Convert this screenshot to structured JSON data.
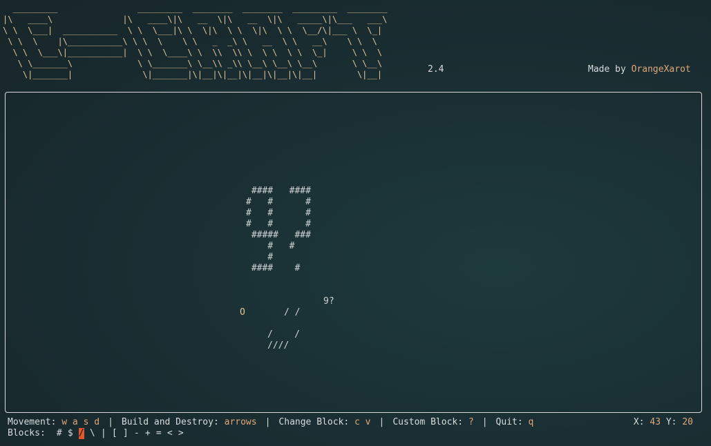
{
  "header": {
    "logo_art": "  _________                _________  ________  ________  _________  ________\n|\\   ____\\              |\\   ____\\|\\   __  \\|\\   __  \\|\\   _____\\|\\___   ___\\\n\\ \\  \\___|  ___________  \\ \\  \\___|\\ \\  \\|\\  \\ \\  \\|\\  \\ \\  \\__/\\|___ \\  \\_|\n \\ \\  \\    |\\___________\\ \\ \\  \\    \\ \\   _  _\\ \\   __  \\ \\   __\\    \\ \\  \\\n  \\ \\  \\___\\|___________|  \\ \\  \\____\\ \\  \\\\  \\\\ \\  \\ \\  \\ \\  \\_|     \\ \\  \\\n   \\ \\_______\\             \\ \\_______\\ \\__\\\\ _\\\\ \\__\\ \\__\\ \\__\\       \\ \\__\\\n    \\|_______|              \\|_______|\\|__|\\|__|\\|__|\\|__|\\|__|        \\|__|",
    "version": "2.4",
    "credit_prefix": "Made by ",
    "author": "OrangeXarot"
  },
  "world": {
    "big_sprite": " ####   ####\n#   #      #\n#   #      #\n#   #      #\n #####   ###\n    #   #\n    #\n ####    #",
    "label_9": "9?",
    "player": "O",
    "slashes_top": "/ /",
    "slashes_mid": "/    /",
    "slashes_bottom": "////"
  },
  "controls": {
    "movement_label": "Movement:",
    "movement_keys": "w a s d",
    "build_label": "Build and Destroy:",
    "build_keys": "arrows",
    "change_label": "Change Block:",
    "change_keys": "c v",
    "custom_label": "Custom Block:",
    "custom_keys": "?",
    "quit_label": "Quit:",
    "quit_keys": "q",
    "separator": "|"
  },
  "coords": {
    "x_label": "X:",
    "x_value": "43",
    "y_label": "Y:",
    "y_value": "20"
  },
  "blocks": {
    "label": "Blocks:",
    "items": [
      "#",
      "$",
      "/",
      "\\",
      "|",
      "[",
      "]",
      "-",
      "+",
      "=",
      "<",
      ">"
    ],
    "selected": "/"
  },
  "colors": {
    "accent": "#e0a77a",
    "logo": "#e3c79b",
    "selected_block_bg": "#e0582b",
    "border": "#d8dada",
    "background": "#1a2f34"
  }
}
